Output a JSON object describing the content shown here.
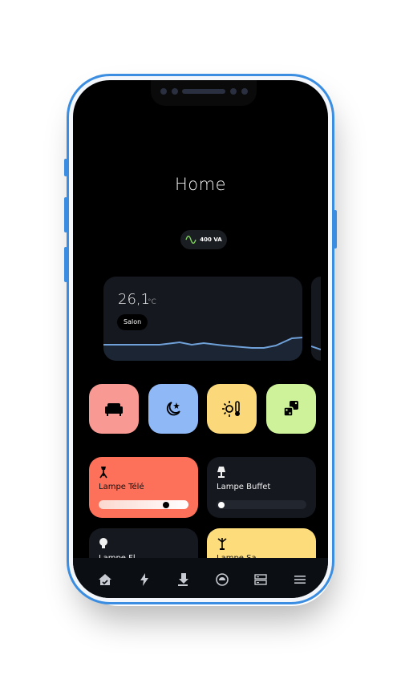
{
  "app": {
    "title": "Home",
    "power": {
      "value": "400 VA",
      "icon": "sine-wave-icon",
      "icon_color": "#7ed35a"
    }
  },
  "temperature_card": {
    "value": "26,1",
    "unit": "°C",
    "room": "Salon",
    "line_color": "#6fa0d8"
  },
  "scenes": [
    {
      "name": "sofa",
      "icon": "sofa-icon",
      "color": "#f89a93"
    },
    {
      "name": "night",
      "icon": "moon-star-icon",
      "color": "#8fb8f7"
    },
    {
      "name": "climate",
      "icon": "sun-thermometer-icon",
      "color": "#fbd97a"
    },
    {
      "name": "games",
      "icon": "dice-icon",
      "color": "#cef29a"
    }
  ],
  "lights": [
    {
      "label": "Lampe Télé",
      "icon": "floor-lamp-icon",
      "on": true,
      "level": 0.78,
      "color": "#fd705a"
    },
    {
      "label": "Lampe Buffet",
      "icon": "table-lamp-icon",
      "on": false,
      "level": 0.0,
      "color": "#15181f"
    },
    {
      "label": "Lampe Fl...",
      "icon": "bulb-icon",
      "on": false,
      "color": "#15181f"
    },
    {
      "label": "Lampe Sa...",
      "icon": "pendant-lamp-icon",
      "on": true,
      "color": "#fddc7c"
    }
  ],
  "tabbar": [
    {
      "name": "home",
      "icon": "home-icon"
    },
    {
      "name": "energy",
      "icon": "lightning-icon"
    },
    {
      "name": "laundry",
      "icon": "iron-icon"
    },
    {
      "name": "vacuum",
      "icon": "robot-vacuum-icon"
    },
    {
      "name": "server",
      "icon": "server-icon"
    },
    {
      "name": "menu",
      "icon": "hamburger-menu-icon"
    }
  ]
}
